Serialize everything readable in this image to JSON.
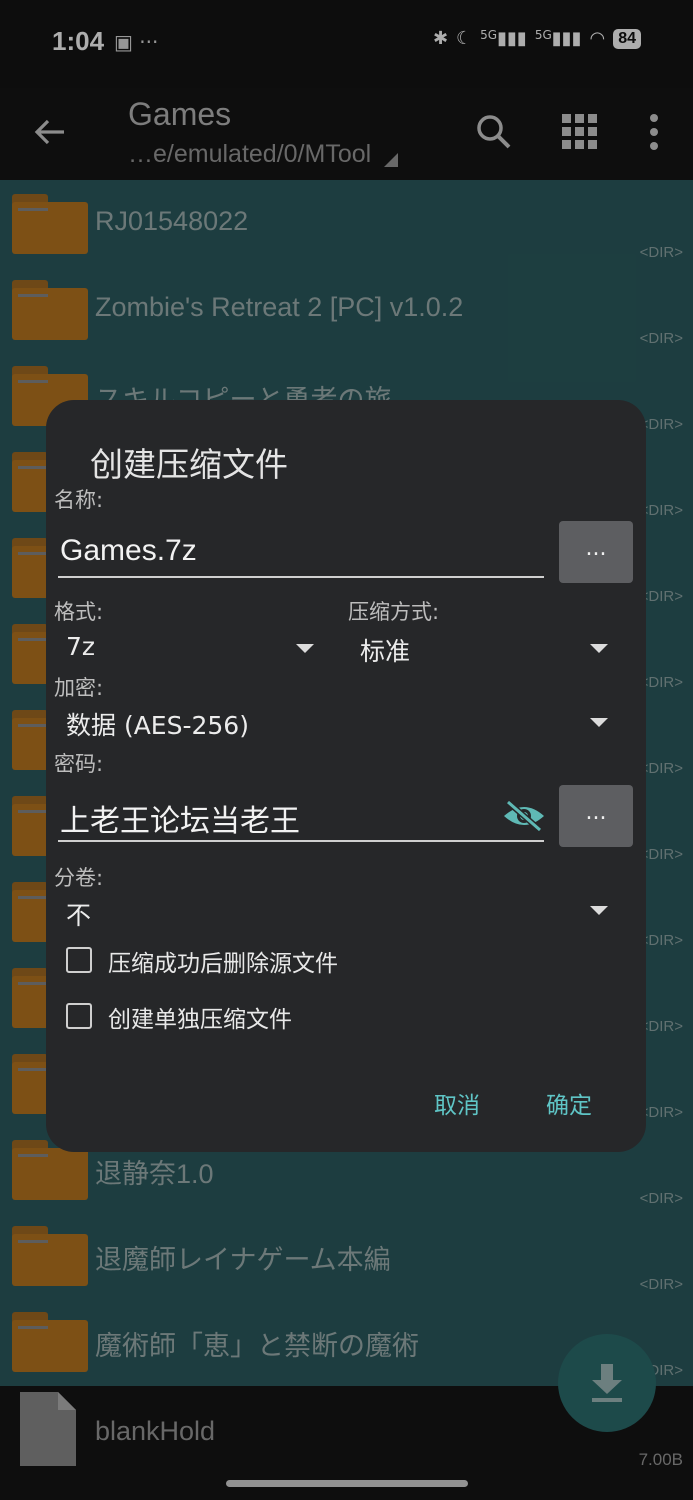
{
  "status": {
    "time": "1:04",
    "left_icons": "▣ ···",
    "network1": "5G",
    "network2": "5G",
    "battery": "84"
  },
  "toolbar": {
    "title": "Games",
    "path": "…e/emulated/0/MTool"
  },
  "files": [
    {
      "name": "RJ01548022",
      "tag": "<DIR>"
    },
    {
      "name": "Zombie's Retreat 2 [PC] v1.0.2",
      "tag": "<DIR>"
    },
    {
      "name": "スキルコピーと勇者の旅",
      "tag": "<DIR>"
    },
    {
      "name": "",
      "tag": "<DIR>"
    },
    {
      "name": "",
      "tag": "<DIR>"
    },
    {
      "name": "",
      "tag": "<DIR>"
    },
    {
      "name": "",
      "tag": "<DIR>"
    },
    {
      "name": "",
      "tag": "<DIR>"
    },
    {
      "name": "",
      "tag": "<DIR>"
    },
    {
      "name": "",
      "tag": "<DIR>"
    },
    {
      "name": "",
      "tag": "<DIR>"
    },
    {
      "name": "退静奈1.0",
      "tag": "<DIR>"
    },
    {
      "name": "退魔師レイナゲーム本編",
      "tag": "<DIR>"
    },
    {
      "name": "魔術師「恵」と禁断の魔術",
      "tag": "<DIR>"
    }
  ],
  "bottom_file": {
    "name": "blankHold",
    "size": "7.00B"
  },
  "dialog": {
    "title": "创建压缩文件",
    "name_label": "名称:",
    "name_value": "Games.7z",
    "browse_label": "...",
    "format_label": "格式:",
    "format_value": "7z",
    "method_label": "压缩方式:",
    "method_value": "标准",
    "encrypt_label": "加密:",
    "encrypt_value": "数据 (AES-256)",
    "password_label": "密码:",
    "password_value": "上老王论坛当老王",
    "password_more": "...",
    "split_label": "分卷:",
    "split_value": "不",
    "delete_source_label": "压缩成功后删除源文件",
    "separate_label": "创建单独压缩文件",
    "cancel_label": "取消",
    "ok_label": "确定"
  },
  "colors": {
    "list_bg": "#2b5b5f",
    "dialog_bg": "#262729",
    "accent": "#5fc5c6",
    "folder": "#b9761f"
  },
  "icons": [
    "back-icon",
    "search-icon",
    "grid-icon",
    "more-vert-icon",
    "folder-icon",
    "file-icon",
    "download-icon",
    "visibility-off-icon",
    "dropdown-caret-icon",
    "checkbox-icon"
  ]
}
